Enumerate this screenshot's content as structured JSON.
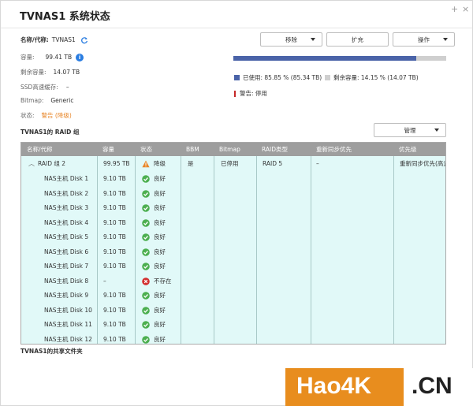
{
  "window": {
    "title": "TVNAS1  系统状态",
    "plus_icon": "+",
    "close_icon": "×"
  },
  "info": {
    "name_label": "名称/代称:",
    "name_value": "TVNAS1",
    "capacity_label": "容量:",
    "capacity_value": "99.41 TB",
    "free_label": "剩余容量:",
    "free_value": "14.07 TB",
    "ssd_label": "SSD高速缓存:",
    "ssd_value": "–",
    "bitmap_label": "Bitmap:",
    "bitmap_value": "Generic",
    "status_label": "状态:",
    "status_value": "警告 (降级)"
  },
  "buttons": {
    "remove": "移除",
    "expand": "扩充",
    "operation": "操作",
    "manage": "管理"
  },
  "usage": {
    "used_fraction": 0.8585,
    "used_text": "已使用: 85.85 % (85.34 TB)",
    "free_text": "剩余容量: 14.15 % (14.07 TB)",
    "warning_text": "警告: 停用",
    "used_color": "#4a63a8",
    "free_color": "#cfcfcf",
    "warning_color": "#c62828"
  },
  "raid_section_title": "TVNAS1的 RAID 组",
  "shared_section_title": "TVNAS1的共享文件夹",
  "table": {
    "headers": [
      "名称/代称",
      "容量",
      "状态",
      "BBM",
      "Bitmap",
      "RAID类型",
      "重新同步优先",
      "优先级"
    ],
    "group_row": {
      "name": "RAID 组 2",
      "capacity": "99.95 TB",
      "status": "降级",
      "bbm": "是",
      "bitmap": "已停用",
      "raid_type": "RAID 5",
      "resync": "–",
      "priority": "重新同步优先(高速"
    },
    "disks": [
      {
        "name": "NAS主机 Disk 1",
        "capacity": "9.10 TB",
        "status": "良好",
        "ok": true
      },
      {
        "name": "NAS主机 Disk 2",
        "capacity": "9.10 TB",
        "status": "良好",
        "ok": true
      },
      {
        "name": "NAS主机 Disk 3",
        "capacity": "9.10 TB",
        "status": "良好",
        "ok": true
      },
      {
        "name": "NAS主机 Disk 4",
        "capacity": "9.10 TB",
        "status": "良好",
        "ok": true
      },
      {
        "name": "NAS主机 Disk 5",
        "capacity": "9.10 TB",
        "status": "良好",
        "ok": true
      },
      {
        "name": "NAS主机 Disk 6",
        "capacity": "9.10 TB",
        "status": "良好",
        "ok": true
      },
      {
        "name": "NAS主机 Disk 7",
        "capacity": "9.10 TB",
        "status": "良好",
        "ok": true
      },
      {
        "name": "NAS主机 Disk 8",
        "capacity": "–",
        "status": "不存在",
        "ok": false
      },
      {
        "name": "NAS主机 Disk 9",
        "capacity": "9.10 TB",
        "status": "良好",
        "ok": true
      },
      {
        "name": "NAS主机 Disk 10",
        "capacity": "9.10 TB",
        "status": "良好",
        "ok": true
      },
      {
        "name": "NAS主机 Disk 11",
        "capacity": "9.10 TB",
        "status": "良好",
        "ok": true
      },
      {
        "name": "NAS主机 Disk 12",
        "capacity": "9.10 TB",
        "status": "良好",
        "ok": true
      }
    ]
  },
  "colors": {
    "ok": "#4caf50",
    "error": "#d32f2f",
    "warning": "#e8872a",
    "table_bg": "#e1f9f8",
    "header_bg": "#9e9e9e"
  },
  "watermark": {
    "brand": "Hao4K",
    "domain": ".CN"
  }
}
